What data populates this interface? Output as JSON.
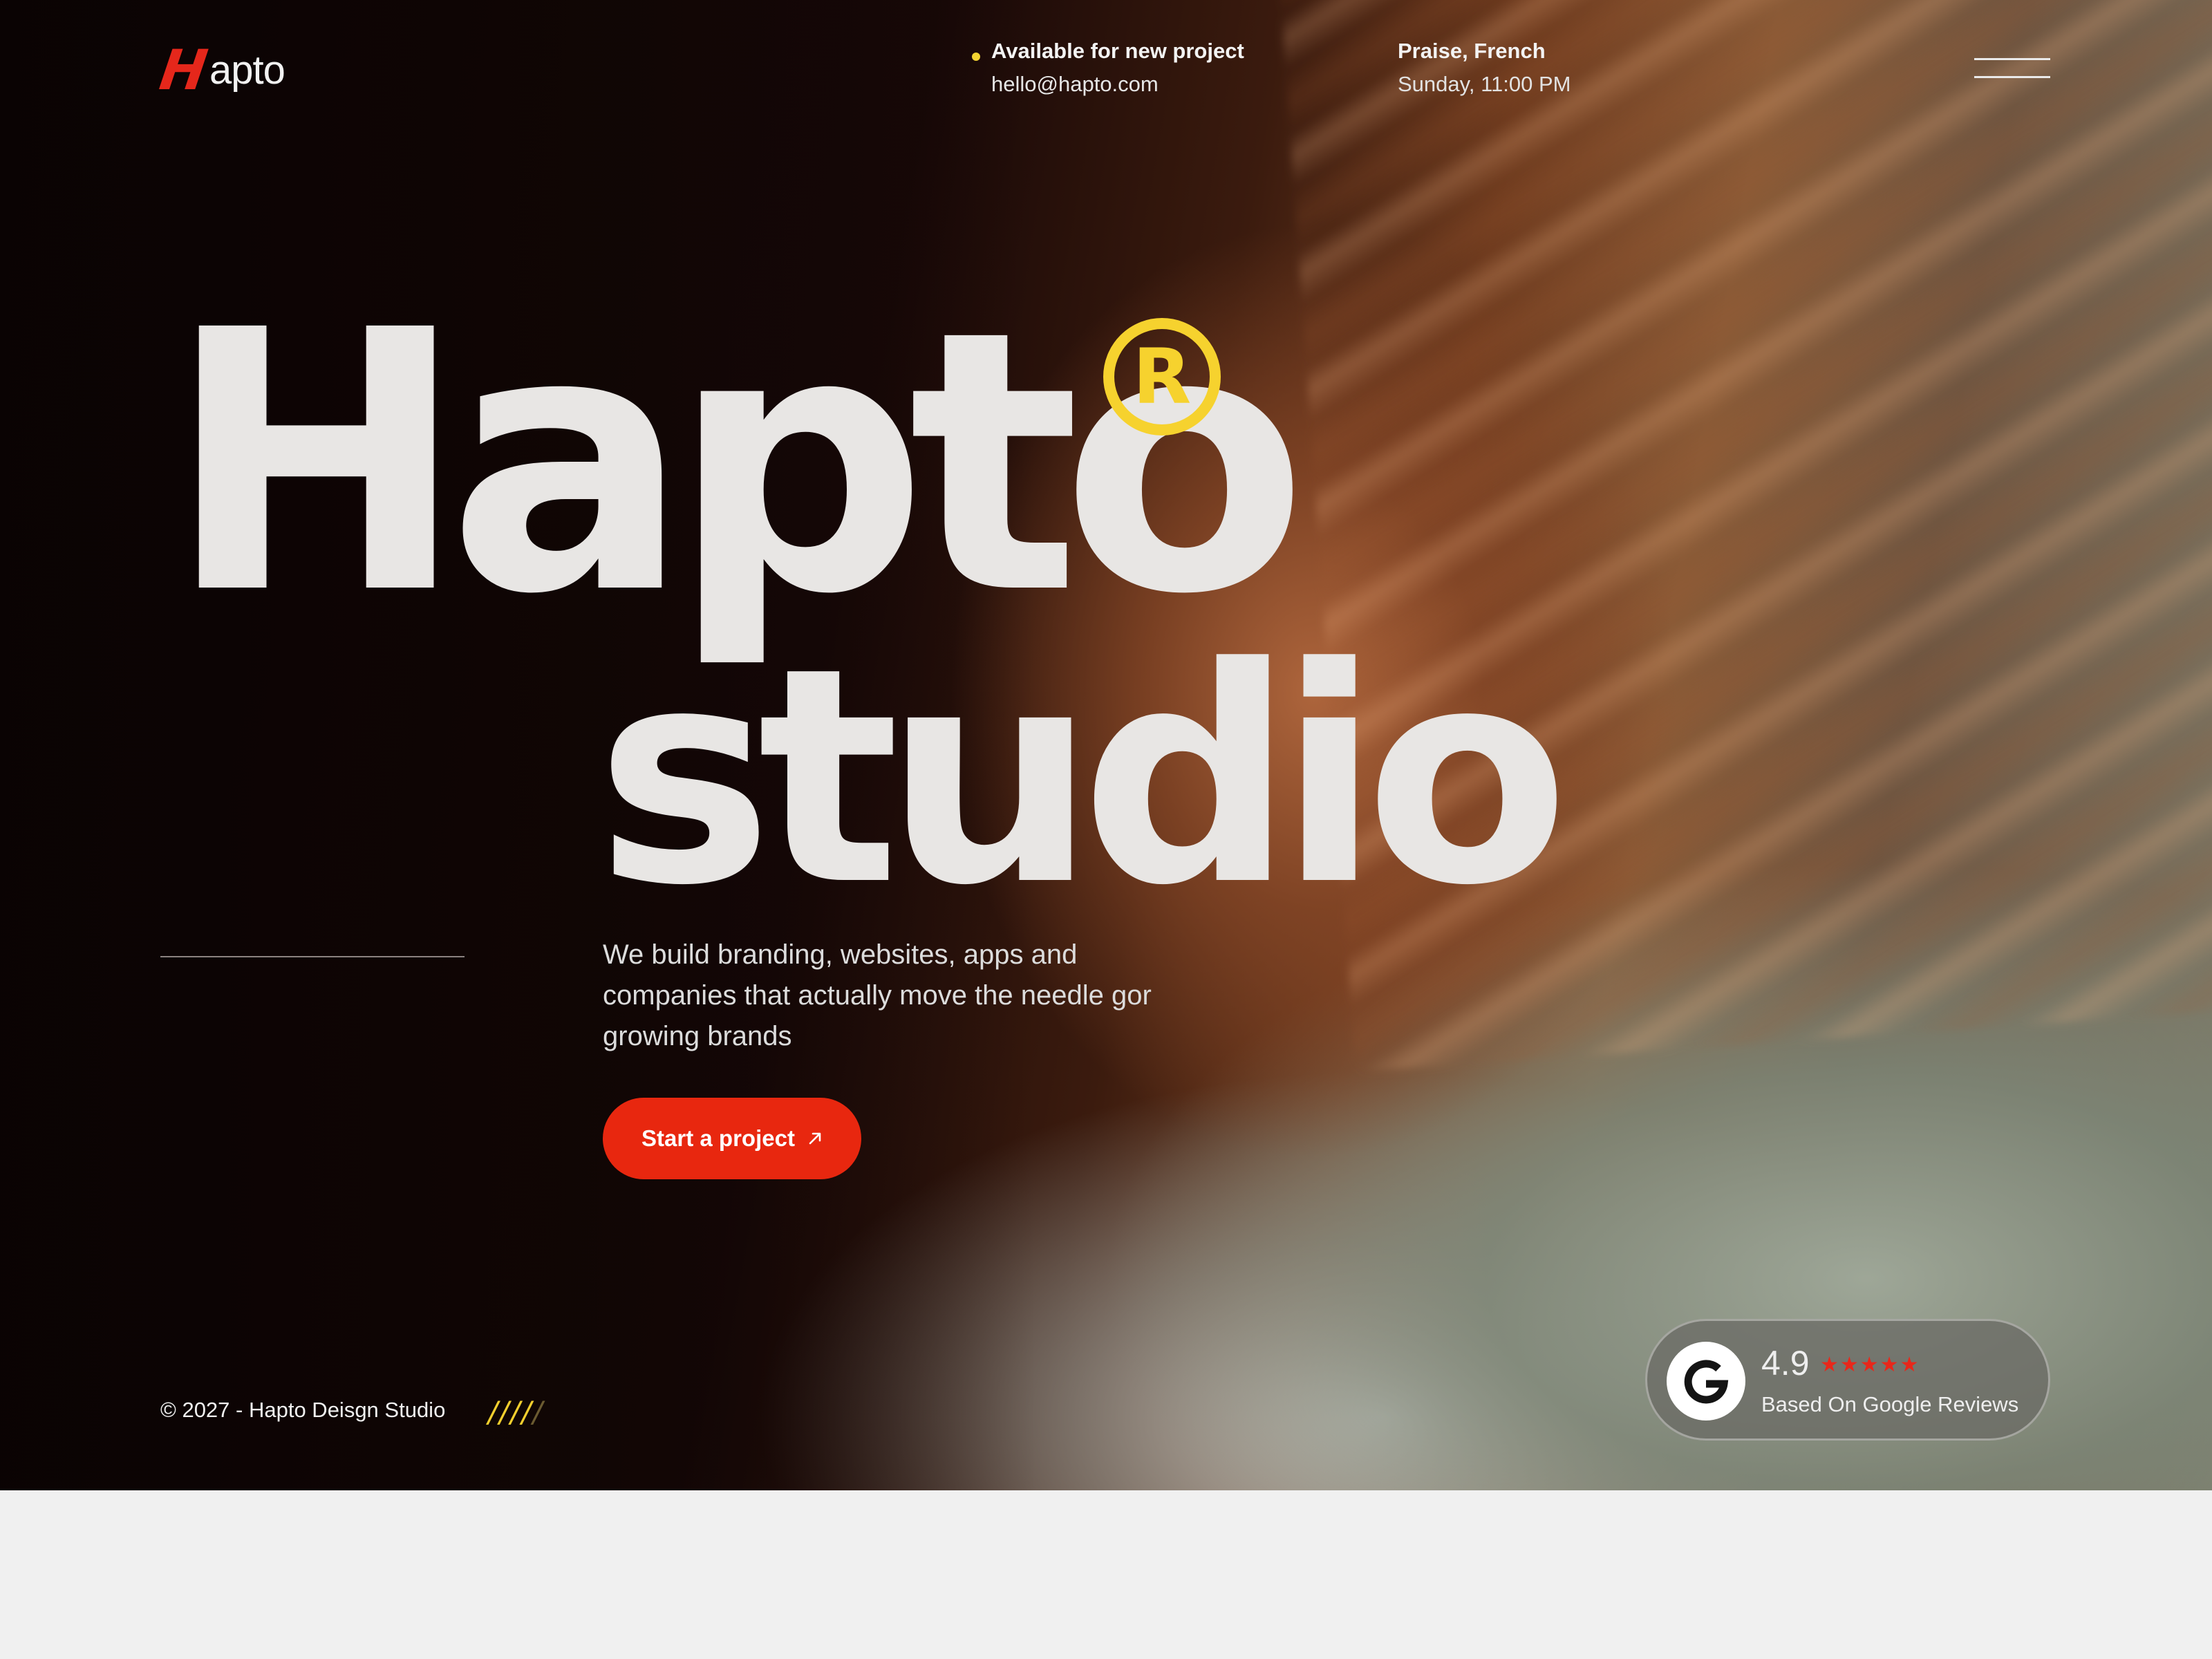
{
  "brand": {
    "logo_mark": "H",
    "logo_text": "apto"
  },
  "header": {
    "availability_title": "Available for new project",
    "availability_email": "hello@hapto.com",
    "location_city": "Praise, French",
    "location_time": "Sunday, 11:00 PM",
    "availability_dot_color": "#f4d431",
    "menu_icon": "hamburger-icon"
  },
  "hero": {
    "headline_line1": "Hapto",
    "registered_mark": "R",
    "headline_line2": "studio",
    "tagline": "We build branding, websites, apps and companies that actually move the needle gor growing brands",
    "cta_label": "Start a project",
    "cta_icon": "arrow-up-right-icon",
    "accent_color": "#e8270f",
    "highlight_color": "#f6d22e"
  },
  "footer": {
    "copyright": "© 2027 - Hapto Deisgn Studio",
    "slashes_bright": "////",
    "slashes_dim": "/"
  },
  "review_badge": {
    "rating": "4.9",
    "stars": "★★★★★",
    "stars_count": 5,
    "caption": "Based On Google Reviews",
    "provider_icon": "google-icon"
  }
}
